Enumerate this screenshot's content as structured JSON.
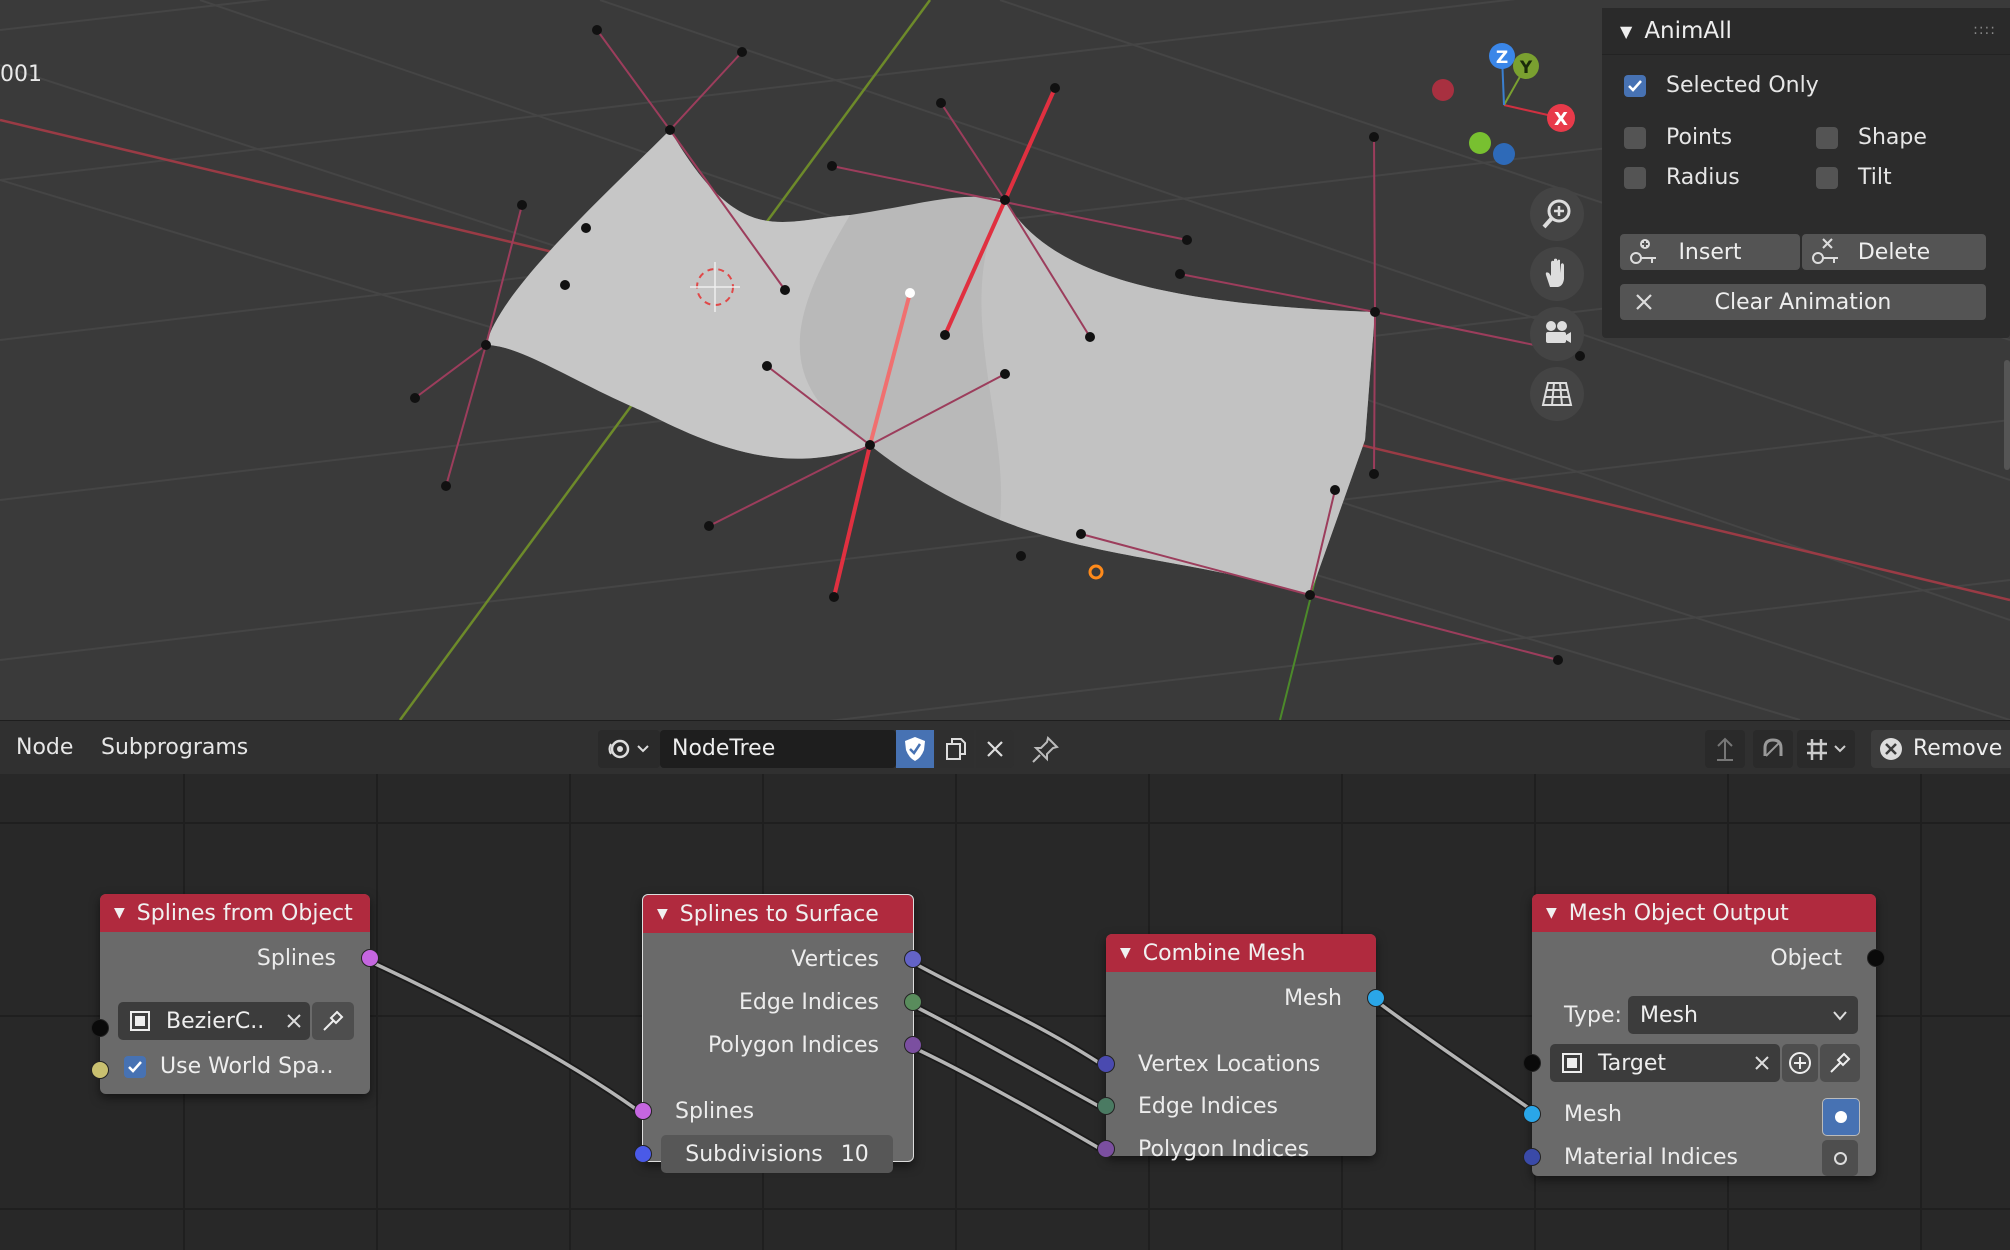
{
  "viewport": {
    "object_name_fragment": "001",
    "gizmo": {
      "x": "X",
      "y": "Y",
      "z": "Z"
    },
    "nav_icons": [
      "zoom-icon",
      "hand-pan-icon",
      "camera-icon",
      "grid-icon"
    ]
  },
  "animall": {
    "title": "AnimAll",
    "selected_only": {
      "label": "Selected Only",
      "checked": true
    },
    "points": {
      "label": "Points",
      "checked": false
    },
    "shape": {
      "label": "Shape",
      "checked": false
    },
    "radius": {
      "label": "Radius",
      "checked": false
    },
    "tilt": {
      "label": "Tilt",
      "checked": false
    },
    "insert_label": "Insert",
    "delete_label": "Delete",
    "clear_label": "Clear Animation"
  },
  "header": {
    "menu_node": "Node",
    "menu_subprograms": "Subprograms",
    "tree_name": "NodeTree",
    "remove_label": "Remove"
  },
  "nodes": {
    "splines_from_object": {
      "title": "Splines from Object",
      "out_splines": "Splines",
      "object_field": "BezierC..",
      "use_world_space": "Use World Spa.."
    },
    "splines_to_surface": {
      "title": "Splines to Surface",
      "out_vertices": "Vertices",
      "out_edge_indices": "Edge Indices",
      "out_polygon_indices": "Polygon Indices",
      "in_splines": "Splines",
      "subdivisions_label": "Subdivisions",
      "subdivisions_value": "10"
    },
    "combine_mesh": {
      "title": "Combine Mesh",
      "out_mesh": "Mesh",
      "in_vertex_locations": "Vertex Locations",
      "in_edge_indices": "Edge Indices",
      "in_polygon_indices": "Polygon Indices"
    },
    "mesh_object_output": {
      "title": "Mesh Object Output",
      "out_object": "Object",
      "type_label": "Type:",
      "type_value": "Mesh",
      "target_field": "Target",
      "in_mesh": "Mesh",
      "in_material_indices": "Material Indices"
    }
  },
  "colors": {
    "node_header": "#b02a3e",
    "accent_blue": "#4772b3",
    "socket_vector": "#6363c7",
    "socket_int": "#598c5c",
    "socket_splines": "#c566e0",
    "socket_mesh": "#2aa6e8"
  }
}
